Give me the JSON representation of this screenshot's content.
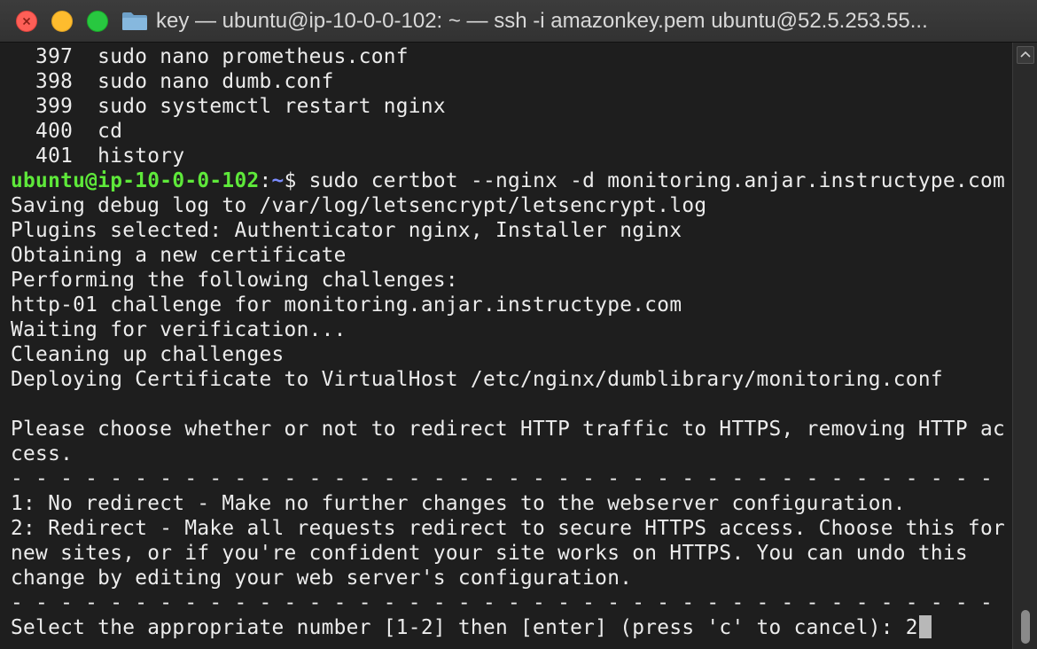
{
  "window": {
    "title": "key — ubuntu@ip-10-0-0-102: ~ — ssh -i amazonkey.pem ubuntu@52.5.253.55..."
  },
  "terminal": {
    "history": [
      "  397  sudo nano prometheus.conf",
      "  398  sudo nano dumb.conf",
      "  399  sudo systemctl restart nginx",
      "  400  cd",
      "  401  history"
    ],
    "prompt": {
      "user_host": "ubuntu@ip-10-0-0-102",
      "colon": ":",
      "path": "~",
      "symbol": "$ ",
      "command": "sudo certbot --nginx -d monitoring.anjar.instructype.com"
    },
    "output": [
      "Saving debug log to /var/log/letsencrypt/letsencrypt.log",
      "Plugins selected: Authenticator nginx, Installer nginx",
      "Obtaining a new certificate",
      "Performing the following challenges:",
      "http-01 challenge for monitoring.anjar.instructype.com",
      "Waiting for verification...",
      "Cleaning up challenges",
      "Deploying Certificate to VirtualHost /etc/nginx/dumblibrary/monitoring.conf",
      "",
      "Please choose whether or not to redirect HTTP traffic to HTTPS, removing HTTP ac",
      "cess.",
      "- - - - - - - - - - - - - - - - - - - - - - - - - - - - - - - - - - - - - - - -",
      "1: No redirect - Make no further changes to the webserver configuration.",
      "2: Redirect - Make all requests redirect to secure HTTPS access. Choose this for",
      "new sites, or if you're confident your site works on HTTPS. You can undo this",
      "change by editing your web server's configuration.",
      "- - - - - - - - - - - - - - - - - - - - - - - - - - - - - - - - - - - - - - - -"
    ],
    "input_prompt": "Select the appropriate number [1-2] then [enter] (press 'c' to cancel): ",
    "input_value": "2"
  },
  "colors": {
    "background": "#1e1e1e",
    "text": "#ececec",
    "prompt_user": "#5ee83a",
    "prompt_path": "#7b8cff"
  },
  "icons": {
    "close": "close-icon",
    "minimize": "minimize-icon",
    "maximize": "maximize-icon",
    "folder": "folder-icon",
    "scroll_up": "chevron-up-icon"
  }
}
